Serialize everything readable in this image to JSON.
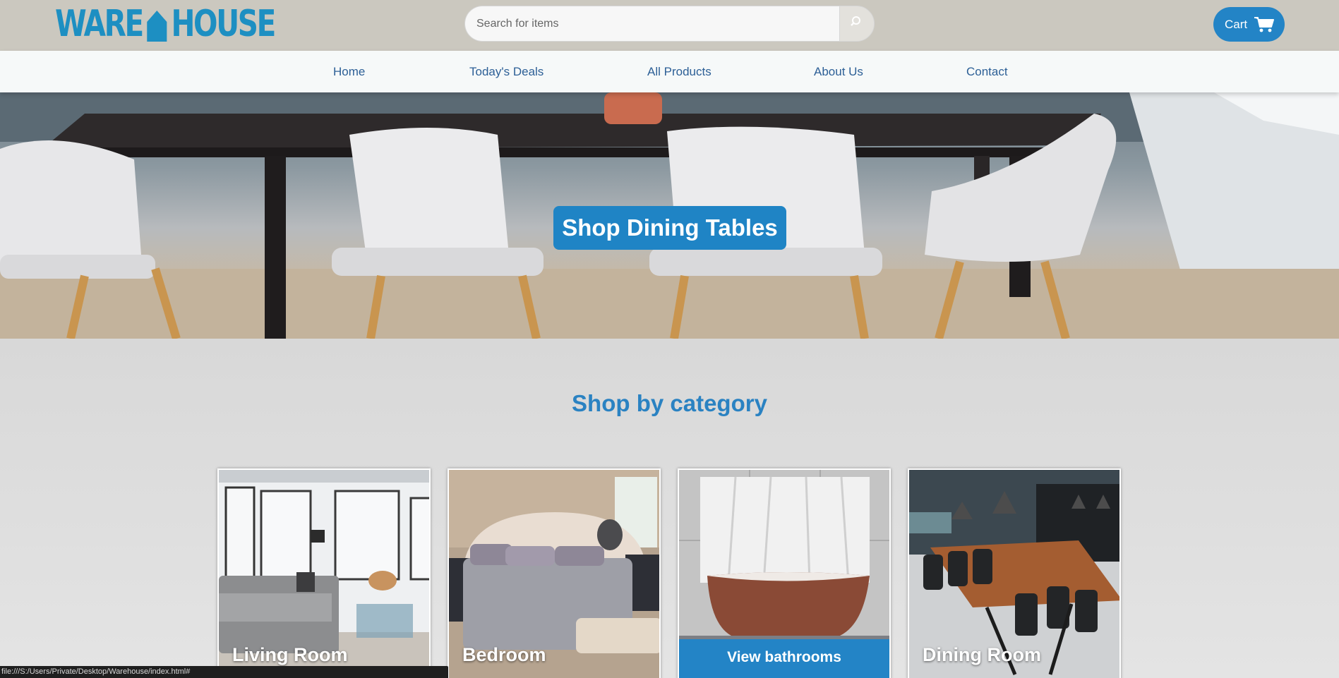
{
  "header": {
    "logo_left": "WARE",
    "logo_right": "HOUSE",
    "search_placeholder": "Search for items",
    "cart_label": "Cart",
    "accent": "#1d8fc2",
    "background": "#cbc8bf"
  },
  "nav": {
    "items": [
      {
        "label": "Home"
      },
      {
        "label": "Today's Deals"
      },
      {
        "label": "All Products"
      },
      {
        "label": "About Us"
      },
      {
        "label": "Contact"
      }
    ]
  },
  "hero": {
    "button_label": "Shop Dining Tables",
    "image": "dining-table-chairs-photo"
  },
  "categories": {
    "title": "Shop by category",
    "cards": [
      {
        "label": "Living Room",
        "image": "living-room-photo"
      },
      {
        "label": "Bedroom",
        "image": "bedroom-photo"
      },
      {
        "label": "View bathrooms",
        "image": "bathroom-photo",
        "style": "button"
      },
      {
        "label": "Dining Room",
        "image": "dining-room-photo"
      }
    ]
  },
  "statusbar": {
    "url": "file:///S:/Users/Private/Desktop/Warehouse/index.html#"
  }
}
